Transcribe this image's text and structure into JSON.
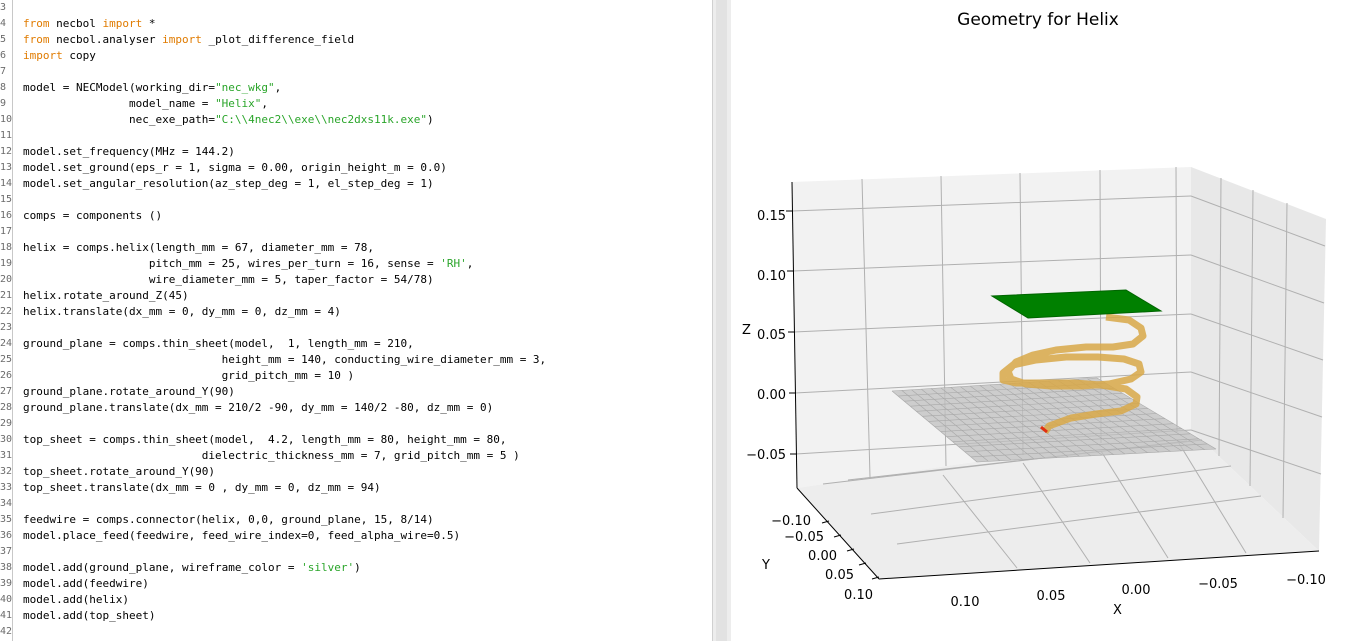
{
  "editor": {
    "lines": [
      {
        "n": "3",
        "parts": []
      },
      {
        "n": "4",
        "parts": [
          {
            "t": "from",
            "c": "kw"
          },
          {
            "t": " necbol "
          },
          {
            "t": "import",
            "c": "kw"
          },
          {
            "t": " *"
          }
        ]
      },
      {
        "n": "5",
        "parts": [
          {
            "t": "from",
            "c": "kw"
          },
          {
            "t": " necbol.analyser "
          },
          {
            "t": "import",
            "c": "kw"
          },
          {
            "t": " _plot_difference_field"
          }
        ]
      },
      {
        "n": "6",
        "parts": [
          {
            "t": "import",
            "c": "kw"
          },
          {
            "t": " copy"
          }
        ]
      },
      {
        "n": "7",
        "parts": []
      },
      {
        "n": "8",
        "parts": [
          {
            "t": "model = NECModel(working_dir="
          },
          {
            "t": "\"nec_wkg\"",
            "c": "str"
          },
          {
            "t": ","
          }
        ]
      },
      {
        "n": "9",
        "parts": [
          {
            "t": "                model_name = "
          },
          {
            "t": "\"Helix\"",
            "c": "str"
          },
          {
            "t": ","
          }
        ]
      },
      {
        "n": "10",
        "parts": [
          {
            "t": "                nec_exe_path="
          },
          {
            "t": "\"C:\\\\4nec2\\\\exe\\\\nec2dxs11k.exe\"",
            "c": "str"
          },
          {
            "t": ")"
          }
        ]
      },
      {
        "n": "11",
        "parts": []
      },
      {
        "n": "12",
        "parts": [
          {
            "t": "model.set_frequency(MHz = 144.2)"
          }
        ]
      },
      {
        "n": "13",
        "parts": [
          {
            "t": "model.set_ground(eps_r = 1, sigma = 0.00, origin_height_m = 0.0)"
          }
        ]
      },
      {
        "n": "14",
        "parts": [
          {
            "t": "model.set_angular_resolution(az_step_deg = 1, el_step_deg = 1)"
          }
        ]
      },
      {
        "n": "15",
        "parts": []
      },
      {
        "n": "16",
        "parts": [
          {
            "t": "comps = components ()"
          }
        ]
      },
      {
        "n": "17",
        "parts": []
      },
      {
        "n": "18",
        "parts": [
          {
            "t": "helix = comps.helix(length_mm = 67, diameter_mm = 78,"
          }
        ]
      },
      {
        "n": "19",
        "parts": [
          {
            "t": "                   pitch_mm = 25, wires_per_turn = 16, sense = "
          },
          {
            "t": "'RH'",
            "c": "str"
          },
          {
            "t": ","
          }
        ]
      },
      {
        "n": "20",
        "parts": [
          {
            "t": "                   wire_diameter_mm = 5, taper_factor = 54/78)"
          }
        ]
      },
      {
        "n": "21",
        "parts": [
          {
            "t": "helix.rotate_around_Z(45)"
          }
        ]
      },
      {
        "n": "22",
        "parts": [
          {
            "t": "helix.translate(dx_mm = 0, dy_mm = 0, dz_mm = 4)"
          }
        ]
      },
      {
        "n": "23",
        "parts": []
      },
      {
        "n": "24",
        "parts": [
          {
            "t": "ground_plane = comps.thin_sheet(model,  1, length_mm = 210,"
          }
        ]
      },
      {
        "n": "25",
        "parts": [
          {
            "t": "                              height_mm = 140, conducting_wire_diameter_mm = 3,"
          }
        ]
      },
      {
        "n": "26",
        "parts": [
          {
            "t": "                              grid_pitch_mm = 10 )"
          }
        ]
      },
      {
        "n": "27",
        "parts": [
          {
            "t": "ground_plane.rotate_around_Y(90)"
          }
        ]
      },
      {
        "n": "28",
        "parts": [
          {
            "t": "ground_plane.translate(dx_mm = 210/2 -90, dy_mm = 140/2 -80, dz_mm = 0)"
          }
        ]
      },
      {
        "n": "29",
        "parts": []
      },
      {
        "n": "30",
        "parts": [
          {
            "t": "top_sheet = comps.thin_sheet(model,  4.2, length_mm = 80, height_mm = 80,"
          }
        ]
      },
      {
        "n": "31",
        "parts": [
          {
            "t": "                           dielectric_thickness_mm = 7, grid_pitch_mm = 5 )"
          }
        ]
      },
      {
        "n": "32",
        "parts": [
          {
            "t": "top_sheet.rotate_around_Y(90)"
          }
        ]
      },
      {
        "n": "33",
        "parts": [
          {
            "t": "top_sheet.translate(dx_mm = 0 , dy_mm = 0, dz_mm = 94)"
          }
        ]
      },
      {
        "n": "34",
        "parts": []
      },
      {
        "n": "35",
        "parts": [
          {
            "t": "feedwire = comps.connector(helix, 0,0, ground_plane, 15, 8/14)"
          }
        ]
      },
      {
        "n": "36",
        "parts": [
          {
            "t": "model.place_feed(feedwire, feed_wire_index=0, feed_alpha_wire=0.5)"
          }
        ]
      },
      {
        "n": "37",
        "parts": []
      },
      {
        "n": "38",
        "parts": [
          {
            "t": "model.add(ground_plane, wireframe_color = "
          },
          {
            "t": "'silver'",
            "c": "str"
          },
          {
            "t": ")"
          }
        ]
      },
      {
        "n": "39",
        "parts": [
          {
            "t": "model.add(feedwire)"
          }
        ]
      },
      {
        "n": "40",
        "parts": [
          {
            "t": "model.add(helix)"
          }
        ]
      },
      {
        "n": "41",
        "parts": [
          {
            "t": "model.add(top_sheet)"
          }
        ]
      },
      {
        "n": "42",
        "parts": []
      }
    ]
  },
  "plot": {
    "title": "Geometry for Helix",
    "z_label": "Z",
    "y_label": "Y",
    "x_label": "X",
    "z_ticks": [
      "0.15",
      "0.10",
      "0.05",
      "0.00",
      "−0.05"
    ],
    "y_ticks": [
      "−0.10",
      "−0.05",
      "0.00",
      "0.05",
      "0.10"
    ],
    "x_ticks": [
      "0.10",
      "0.05",
      "0.00",
      "−0.05",
      "−0.10"
    ],
    "colors": {
      "ground_plane": "#c0c0c0",
      "top_sheet": "#008000",
      "helix": "#d8a848",
      "feed": "#e03010",
      "grid": "#b0b0b0",
      "pane": "#f2f2f2"
    }
  }
}
